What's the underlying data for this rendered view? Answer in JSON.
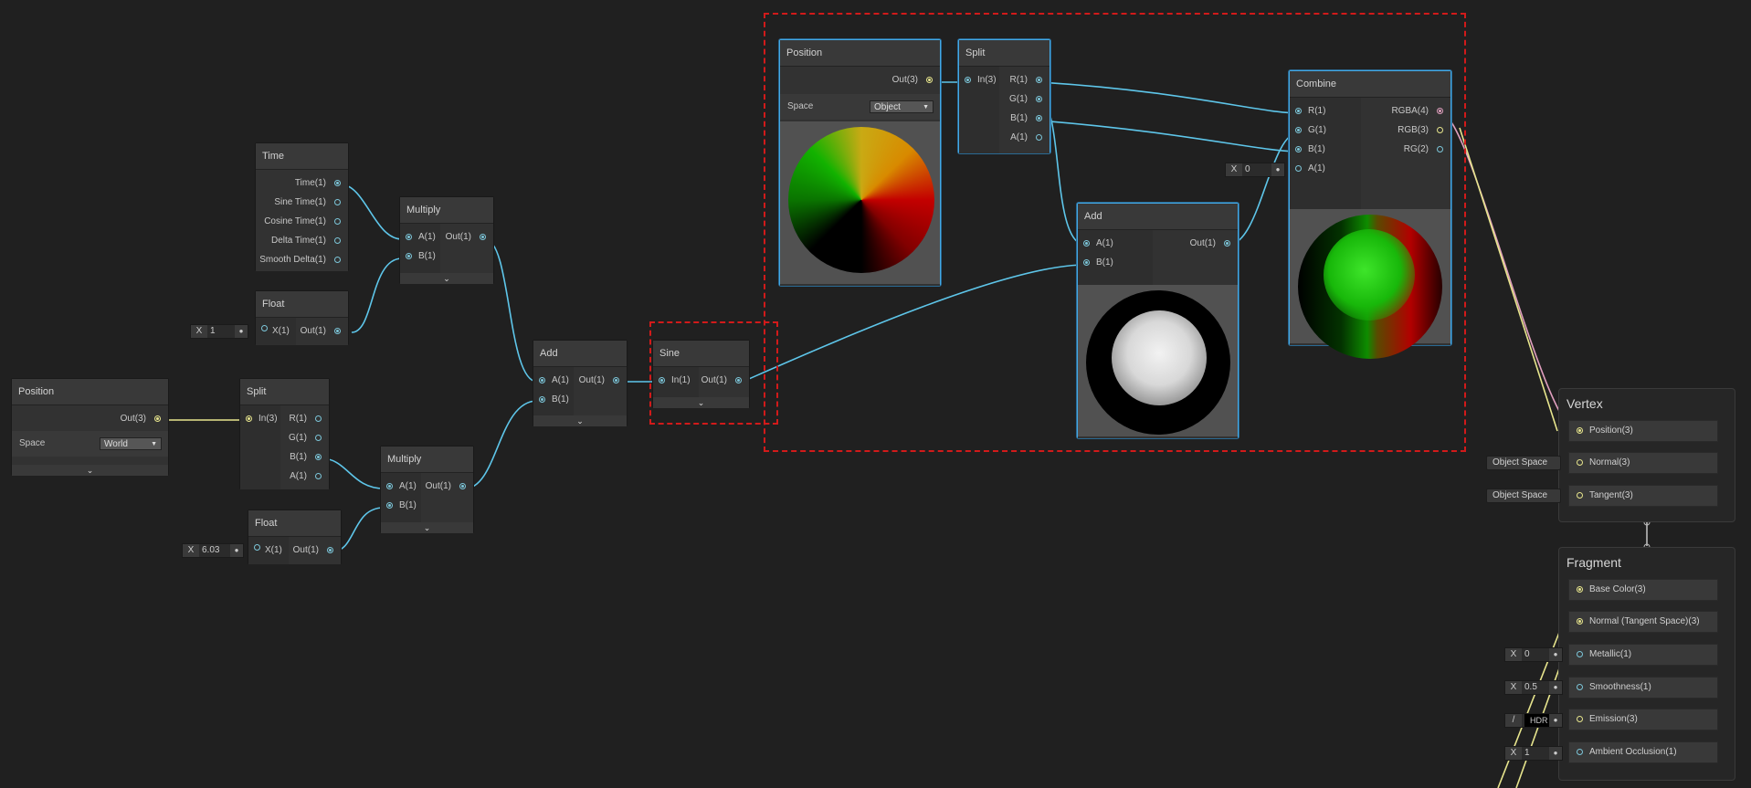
{
  "colors": {
    "background": "#202020",
    "selection": "#44a9e6",
    "wire_vector1": "#5ec6ea",
    "wire_vector3": "#e7e58d",
    "wire_vector4": "#e09fbe",
    "highlight_box": "#d21a1a"
  },
  "time_node": {
    "title": "Time",
    "outputs": [
      "Time(1)",
      "Sine Time(1)",
      "Cosine Time(1)",
      "Delta Time(1)",
      "Smooth Delta(1)"
    ]
  },
  "float_node_1": {
    "title": "Float",
    "input": "X(1)",
    "output": "Out(1)",
    "x_label": "X",
    "x_value": "1"
  },
  "multiply_node_1": {
    "title": "Multiply",
    "inputs": [
      "A(1)",
      "B(1)"
    ],
    "output": "Out(1)"
  },
  "position_node_world": {
    "title": "Position",
    "output": "Out(3)",
    "space_label": "Space",
    "space_value": "World"
  },
  "split_node_1": {
    "title": "Split",
    "input": "In(3)",
    "outputs": [
      "R(1)",
      "G(1)",
      "B(1)",
      "A(1)"
    ]
  },
  "float_node_2": {
    "title": "Float",
    "input": "X(1)",
    "output": "Out(1)",
    "x_label": "X",
    "x_value": "6.03"
  },
  "multiply_node_2": {
    "title": "Multiply",
    "inputs": [
      "A(1)",
      "B(1)"
    ],
    "output": "Out(1)"
  },
  "add_node_1": {
    "title": "Add",
    "inputs": [
      "A(1)",
      "B(1)"
    ],
    "output": "Out(1)"
  },
  "sine_node": {
    "title": "Sine",
    "input": "In(1)",
    "output": "Out(1)"
  },
  "position_node_object": {
    "title": "Position",
    "output": "Out(3)",
    "space_label": "Space",
    "space_value": "Object"
  },
  "split_node_2": {
    "title": "Split",
    "input": "In(3)",
    "outputs": [
      "R(1)",
      "G(1)",
      "B(1)",
      "A(1)"
    ]
  },
  "add_node_2": {
    "title": "Add",
    "inputs": [
      "A(1)",
      "B(1)"
    ],
    "output": "Out(1)"
  },
  "combine_node": {
    "title": "Combine",
    "inputs": [
      "R(1)",
      "G(1)",
      "B(1)",
      "A(1)"
    ],
    "outputs": [
      "RGBA(4)",
      "RGB(3)",
      "RG(2)"
    ],
    "a_field_label": "X",
    "a_field_value": "0"
  },
  "vertex_block": {
    "title": "Vertex",
    "slots": [
      "Position(3)",
      "Normal(3)",
      "Tangent(3)"
    ],
    "normal_space": "Object Space",
    "tangent_space": "Object Space"
  },
  "fragment_block": {
    "title": "Fragment",
    "slots": [
      "Base Color(3)",
      "Normal (Tangent Space)(3)",
      "Metallic(1)",
      "Smoothness(1)",
      "Emission(3)",
      "Ambient Occlusion(1)"
    ],
    "metallic_label": "X",
    "metallic_value": "0",
    "smoothness_label": "X",
    "smoothness_value": "0.5",
    "emission_mode": "HDR",
    "ao_label": "X",
    "ao_value": "1"
  },
  "chevron": "⌄"
}
